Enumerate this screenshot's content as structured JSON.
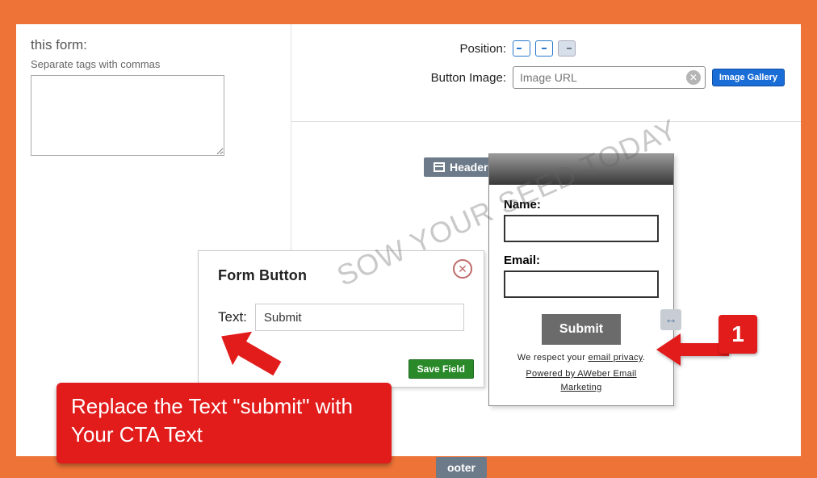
{
  "left": {
    "title_line1": "this form:",
    "subtitle": "Separate tags with commas"
  },
  "controls": {
    "position_label": "Position:",
    "button_image_label": "Button Image:",
    "image_url_placeholder": "Image URL",
    "gallery_label": "Image Gallery"
  },
  "preview": {
    "header_tab": "Header",
    "footer_tab": "ooter",
    "name_label": "Name:",
    "email_label": "Email:",
    "submit_label": "Submit",
    "privacy_prefix": "We respect your ",
    "privacy_link": "email privacy",
    "privacy_suffix": ".",
    "powered_line1": "Powered by AWeber Email",
    "powered_line2": "Marketing",
    "resize_glyph": "↔"
  },
  "popover": {
    "title": "Form Button",
    "text_label": "Text:",
    "text_value": "Submit",
    "save_label": "Save Field",
    "close_glyph": "✕"
  },
  "annotation": {
    "text": "Replace the Text \"submit\" with Your CTA Text",
    "badge": "1"
  },
  "watermark": "SOW YOUR SEED TODAY"
}
